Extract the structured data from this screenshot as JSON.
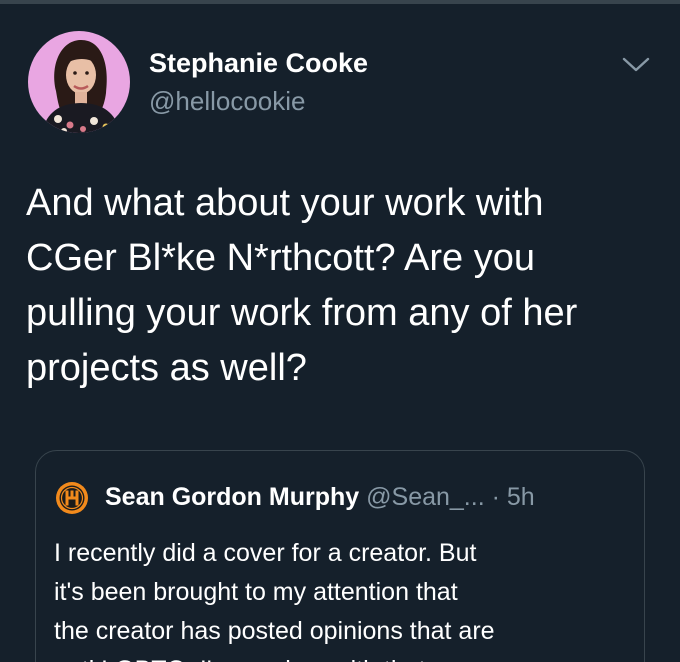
{
  "tweet": {
    "author_name": "Stephanie Cooke",
    "author_handle": "@hellocookie",
    "avatar_icon": "profile-photo",
    "menu_icon": "chevron-down-icon",
    "text_lines": [
      "And what about your work with",
      "CGer Bl*ke N*rthcott? Are you",
      "pulling your work from any of her",
      "projects as well?"
    ]
  },
  "quoted_tweet": {
    "author_name": "Sean Gordon Murphy",
    "author_handle": "@Sean_...",
    "separator": "·",
    "time": "5h",
    "avatar_icon": "sgm-logo-icon",
    "text_lines": [
      "I recently did a cover for a creator. But",
      "it's been brought to my attention that",
      "the creator has posted opinions that are",
      "anti LGBTQ. I've spoken with that"
    ]
  },
  "colors": {
    "background": "#15202b",
    "border": "#38444d",
    "secondary_text": "#8899a6",
    "avatar_bg": "#e7a3e0",
    "logo_orange": "#f28a1c"
  }
}
